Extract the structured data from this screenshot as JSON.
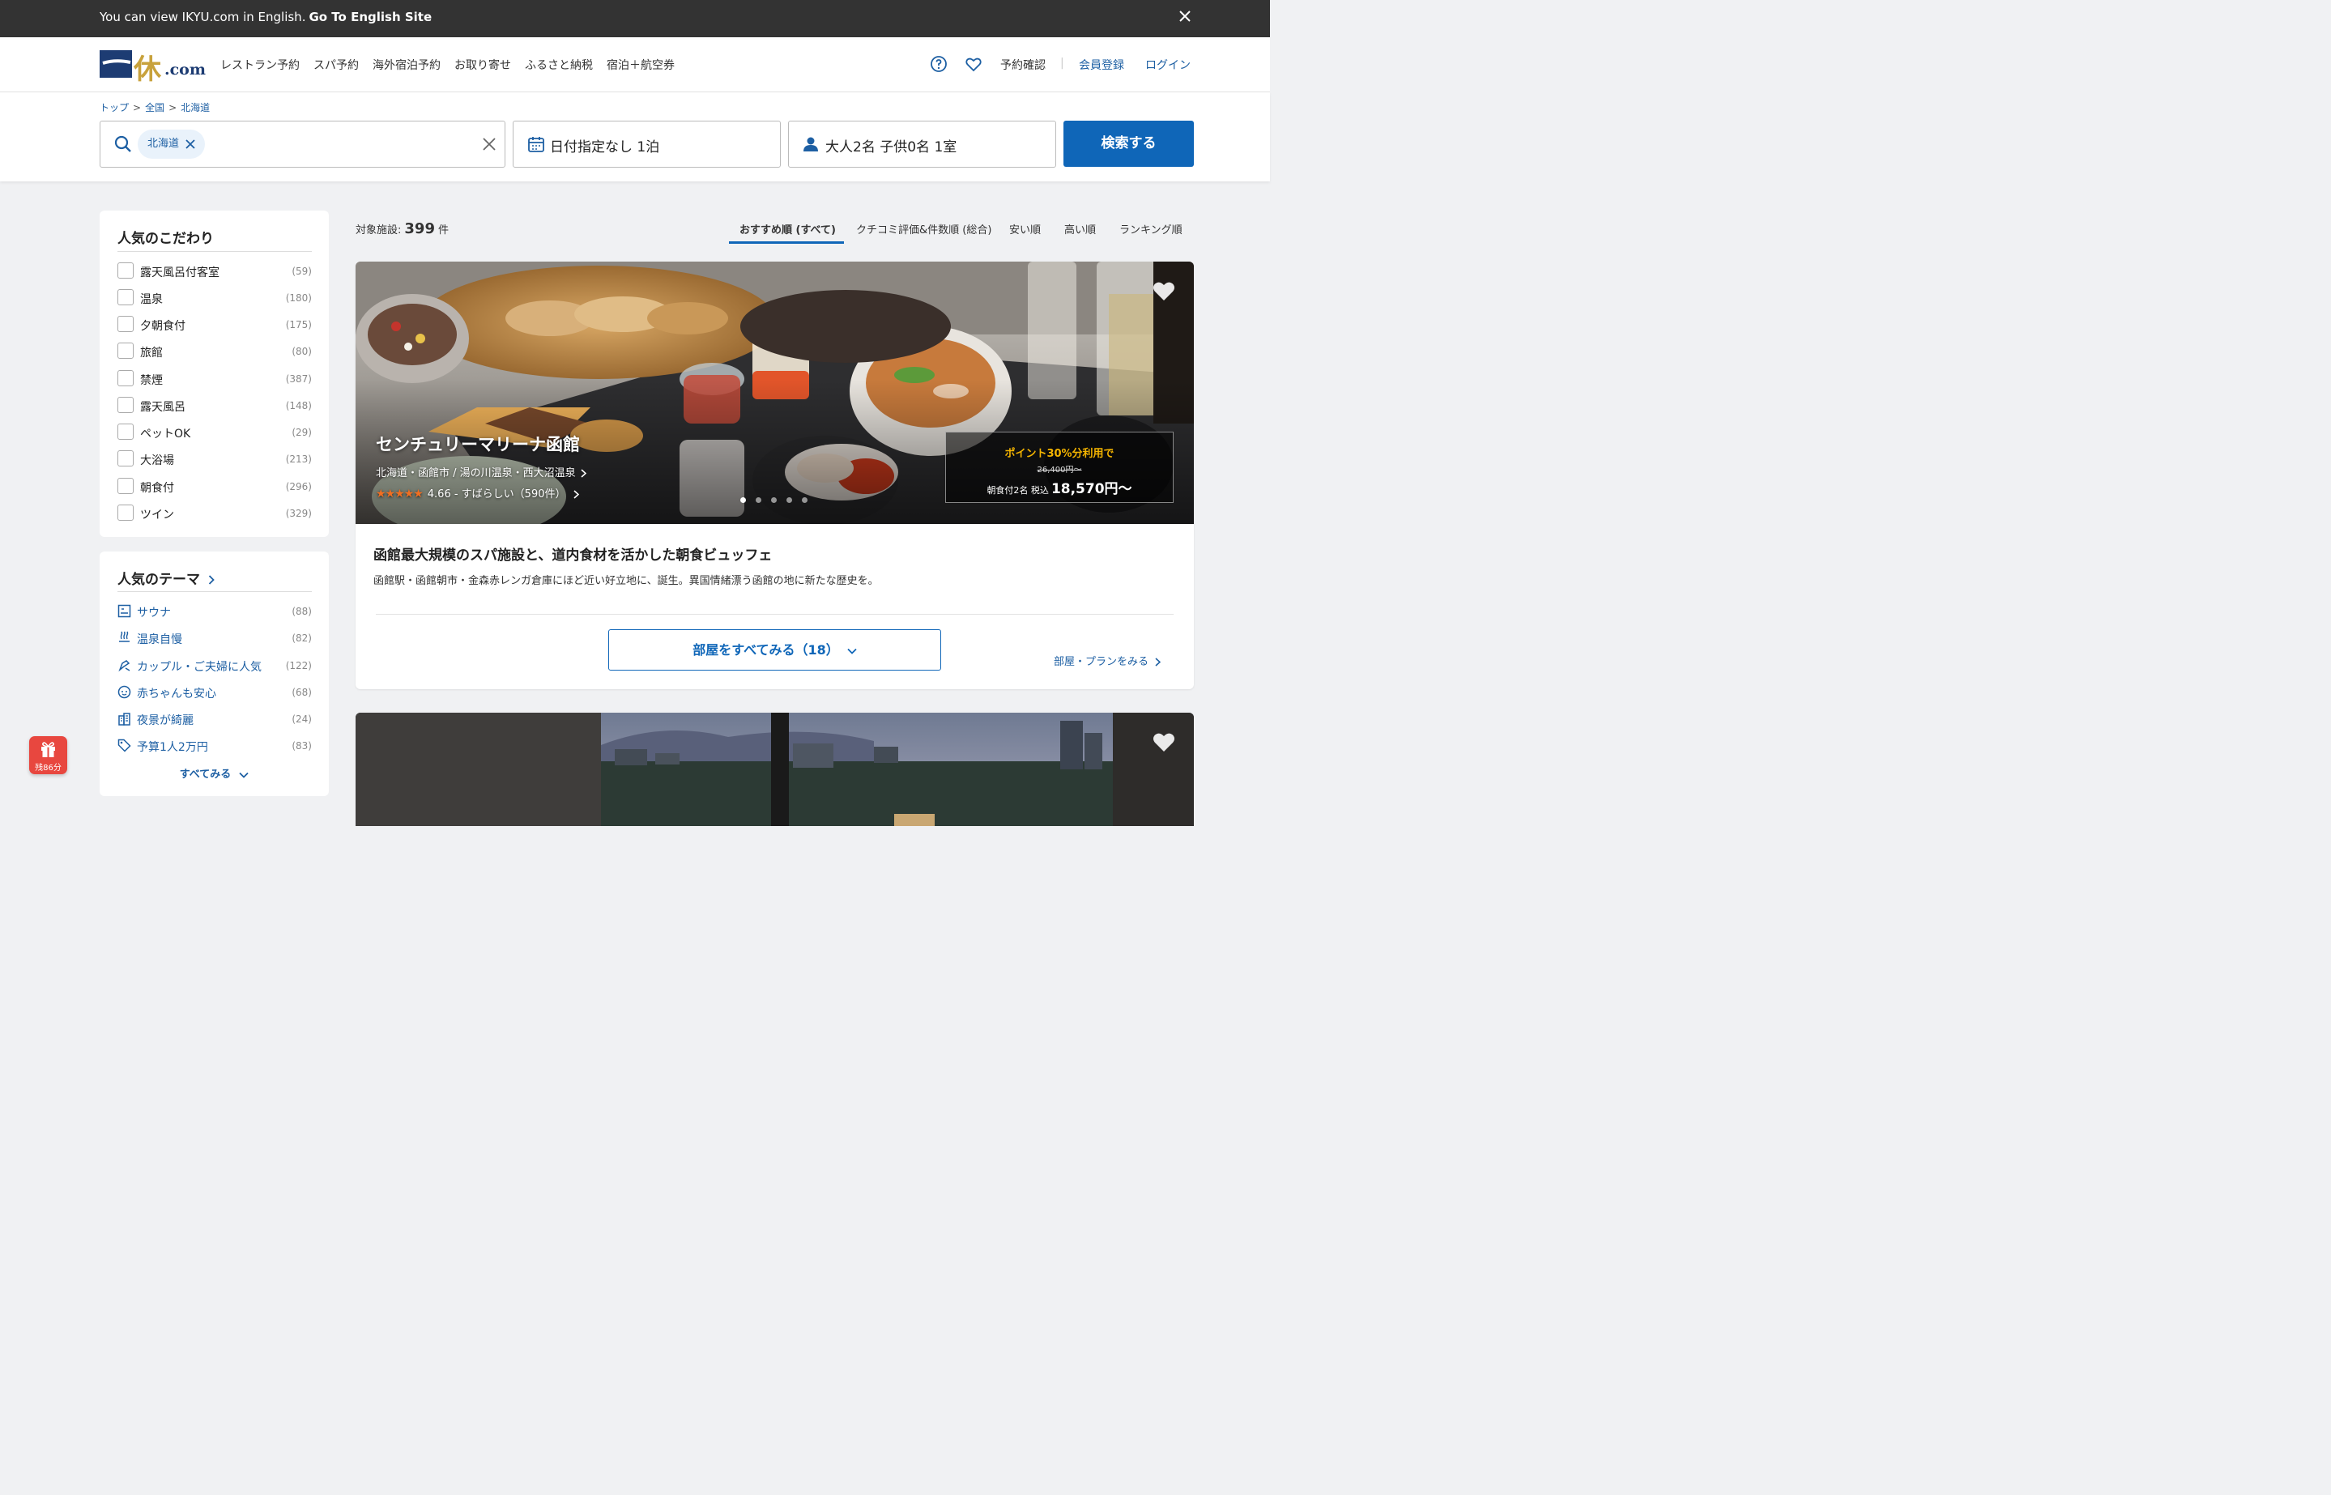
{
  "banner": {
    "message": "You can view IKYU.com in English.",
    "link": "Go To English Site"
  },
  "header": {
    "logo_kanji": "休",
    "logo_com": ".com",
    "nav": [
      "レストラン予約",
      "スパ予約",
      "海外宿泊予約",
      "お取り寄せ",
      "ふるさと納税",
      "宿泊＋航空券"
    ],
    "reservation": "予約確認",
    "register": "会員登録",
    "login": "ログイン"
  },
  "breadcrumb": [
    "トップ",
    "全国",
    "北海道"
  ],
  "breadcrumb_sep": ">",
  "search": {
    "location_chip": "北海道",
    "date": "日付指定なし 1泊",
    "guests": "大人2名 子供0名 1室",
    "button": "検索する"
  },
  "filters": {
    "title": "人気のこだわり",
    "items": [
      {
        "label": "露天風呂付客室",
        "count": "(59)"
      },
      {
        "label": "温泉",
        "count": "(180)"
      },
      {
        "label": "夕朝食付",
        "count": "(175)"
      },
      {
        "label": "旅館",
        "count": "(80)"
      },
      {
        "label": "禁煙",
        "count": "(387)"
      },
      {
        "label": "露天風呂",
        "count": "(148)"
      },
      {
        "label": "ペットOK",
        "count": "(29)"
      },
      {
        "label": "大浴場",
        "count": "(213)"
      },
      {
        "label": "朝食付",
        "count": "(296)"
      },
      {
        "label": "ツイン",
        "count": "(329)"
      }
    ]
  },
  "themes": {
    "title": "人気のテーマ",
    "items": [
      {
        "label": "サウナ",
        "count": "(88)",
        "icon": "sauna-icon"
      },
      {
        "label": "温泉自慢",
        "count": "(82)",
        "icon": "hot-spring-icon"
      },
      {
        "label": "カップル・ご夫婦に人気",
        "count": "(122)",
        "icon": "couple-icon"
      },
      {
        "label": "赤ちゃんも安心",
        "count": "(68)",
        "icon": "baby-icon"
      },
      {
        "label": "夜景が綺麗",
        "count": "(24)",
        "icon": "night-view-icon"
      },
      {
        "label": "予算1人2万円",
        "count": "(83)",
        "icon": "price-tag-icon"
      }
    ],
    "see_all": "すべてみる"
  },
  "results": {
    "count_label": "対象施設:",
    "count": "399",
    "count_unit": "件",
    "sort_options": [
      "おすすめ順 (すべて)",
      "クチコミ評価&件数順 (総合)",
      "安い順",
      "高い順",
      "ランキング順"
    ]
  },
  "hotel": {
    "name": "センチュリーマリーナ函館",
    "location": "北海道・函館市 / 湯の川温泉・西大沼温泉",
    "stars": "★★★★★",
    "rating": "4.66 - すばらしい（590件）",
    "point_note": "ポイント30%分利用で",
    "old_price": "26,400円〜",
    "price_prefix": "朝食付2名 税込",
    "price": "18,570円〜",
    "headline": "函館最大規模のスパ施設と、道内食材を活かした朝食ビュッフェ",
    "description": "函館駅・函館朝市・金森赤レンガ倉庫にほど近い好立地に、誕生。異国情緒漂う函館の地に新たな歴史を。",
    "rooms_button": "部屋をすべてみる（18）",
    "plan_link": "部屋・プランをみる"
  },
  "gift": {
    "label": "残86分"
  },
  "colors": {
    "accent": "#0f66b8",
    "star": "#f26f21",
    "point": "#f4b400",
    "banner_bg": "#333333"
  }
}
